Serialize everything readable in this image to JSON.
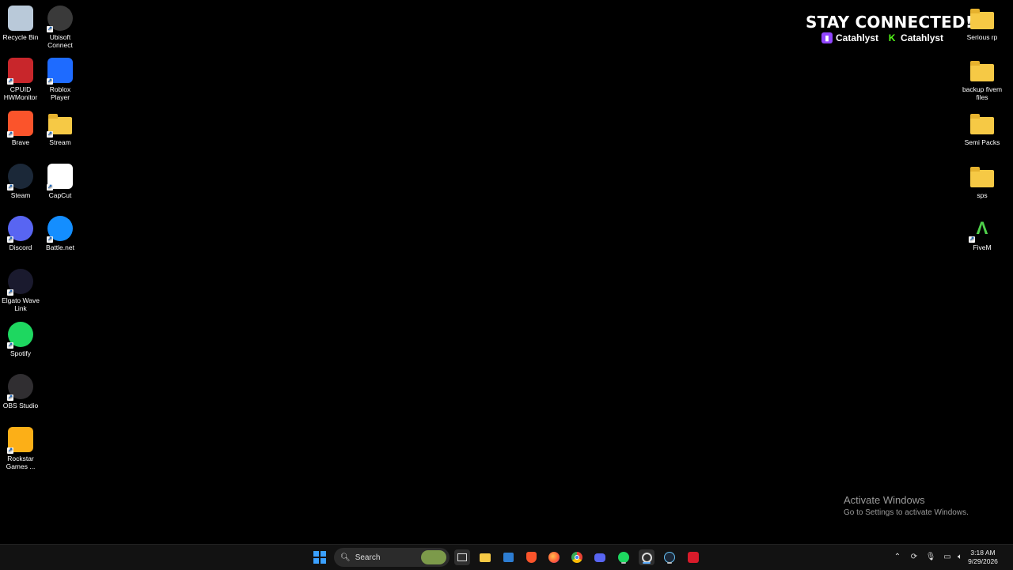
{
  "desktop_icons_left": [
    {
      "label": "Recycle Bin",
      "icon": "recycle-bin-icon",
      "color": "#b9c9d9"
    },
    {
      "label": "Ubisoft Connect",
      "icon": "ubisoft-icon",
      "color": "#3a3a3a"
    },
    {
      "label": "CPUID HWMonitor",
      "icon": "hwmonitor-icon",
      "color": "#c8262b"
    },
    {
      "label": "Roblox Player",
      "icon": "roblox-icon",
      "color": "#1e6bff"
    },
    {
      "label": "Brave",
      "icon": "brave-icon",
      "color": "#fb542b"
    },
    {
      "label": "Stream",
      "icon": "folder-icon",
      "color": "#f6c945"
    },
    {
      "label": "Steam",
      "icon": "steam-icon",
      "color": "#1b2838"
    },
    {
      "label": "CapCut",
      "icon": "capcut-icon",
      "color": "#ffffff"
    },
    {
      "label": "Discord",
      "icon": "discord-icon",
      "color": "#5865f2"
    },
    {
      "label": "Battle.net",
      "icon": "battlenet-icon",
      "color": "#148eff"
    },
    {
      "label": "Elgato Wave Link",
      "icon": "wavelink-icon",
      "color": "#1a1a2e"
    },
    {
      "label": "Spotify",
      "icon": "spotify-icon",
      "color": "#1ed760"
    },
    {
      "label": "OBS Studio",
      "icon": "obs-icon",
      "color": "#302e31"
    },
    {
      "label": "Rockstar Games ...",
      "icon": "rockstar-icon",
      "color": "#fcaf17"
    }
  ],
  "desktop_icons_right": [
    {
      "label": "Serious rp",
      "icon": "folder-icon"
    },
    {
      "label": "backup fivem files",
      "icon": "folder-icon"
    },
    {
      "label": "Semi Packs",
      "icon": "folder-icon"
    },
    {
      "label": "sps",
      "icon": "folder-icon"
    },
    {
      "label": "FiveM",
      "icon": "fivem-icon"
    }
  ],
  "overlay": {
    "title": "STAY CONNECTED!",
    "twitch_handle": "Catahlyst",
    "kick_handle": "Catahlyst",
    "twitch_color": "#9146ff",
    "kick_color": "#53fc18"
  },
  "activation": {
    "line1": "Activate Windows",
    "line2": "Go to Settings to activate Windows."
  },
  "taskbar": {
    "search_placeholder": "Search",
    "apps": [
      "start-icon",
      "task-view-icon",
      "file-explorer-icon",
      "store-icon",
      "brave-icon",
      "firefox-icon",
      "chrome-icon",
      "discord-icon",
      "spotify-icon",
      "obs-icon",
      "steam-icon",
      "rockstar-icon"
    ],
    "time": "3:18 AM",
    "date": "9/29/2026"
  }
}
